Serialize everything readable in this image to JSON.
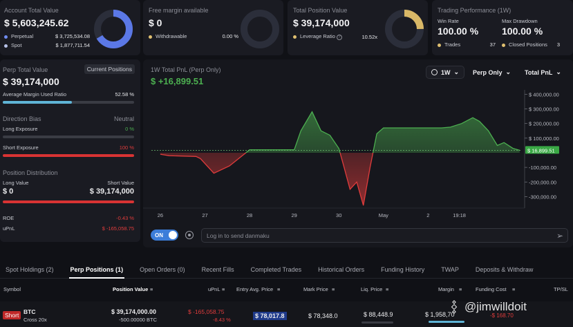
{
  "account": {
    "title": "Account Total Value",
    "value": "$ 5,603,245.62",
    "perp_label": "Perpetual",
    "perp_value": "$ 3,725,534.08",
    "spot_label": "Spot",
    "spot_value": "$ 1,877,711.54"
  },
  "margin": {
    "title": "Free margin available",
    "value": "$ 0",
    "withdrawable_label": "Withdrawable",
    "withdrawable_value": "0.00 %"
  },
  "position": {
    "title": "Total Position Value",
    "value": "$ 39,174,000",
    "leverage_label": "Leverage Ratio",
    "leverage_value": "10.52x"
  },
  "performance": {
    "title": "Trading Performance (1W)",
    "winrate_label": "Win Rate",
    "winrate_value": "100.00 %",
    "drawdown_label": "Max Drawdown",
    "drawdown_value": "100.00 %",
    "trades_label": "Trades",
    "trades_value": "37",
    "closed_label": "Closed Positions",
    "closed_value": "3"
  },
  "perp": {
    "title": "Perp Total Value",
    "button": "Current Positions",
    "value": "$ 39,174,000",
    "margin_used_label": "Average Margin Used Ratio",
    "margin_used_value": "52.58 %",
    "margin_used_fraction": 0.5258,
    "bias_label": "Direction Bias",
    "bias_value": "Neutral",
    "long_label": "Long Exposure",
    "long_value": "0 %",
    "short_label": "Short Exposure",
    "short_value": "100 %",
    "dist_label": "Position Distribution",
    "long_value_label": "Long Value",
    "short_value_label": "Short Value",
    "long_amount": "$ 0",
    "short_amount": "$ 39,174,000",
    "roe_label": "ROE",
    "roe_value": "-0.43 %",
    "upnl_label": "uPnL",
    "upnl_value": "$ -165,058.75"
  },
  "chart": {
    "title": "1W Total PnL (Perp Only)",
    "value": "$ +16,899.51",
    "period": "1W",
    "mode": "Perp Only",
    "metric": "Total PnL",
    "current_label": "$ 16,899.51"
  },
  "chart_data": {
    "type": "area",
    "title": "1W Total PnL (Perp Only)",
    "x_ticks": [
      "26",
      "27",
      "28",
      "29",
      "30",
      "May",
      "2",
      "19:18"
    ],
    "y_ticks": [
      "$ 400,000.00",
      "$ 300,000.00",
      "$ 200,000.00",
      "$ 100,000.00",
      "$ 0",
      "-100,000.00",
      "-200,000.00",
      "-300,000.00"
    ],
    "y_tick_values": [
      400000,
      300000,
      200000,
      100000,
      0,
      -100000,
      -200000,
      -300000
    ],
    "ylim": [
      -350000,
      430000
    ],
    "x": [
      0,
      0.2,
      0.8,
      0.9,
      1.2,
      1.55,
      2.0,
      2.5,
      3.0,
      3.15,
      3.4,
      3.6,
      3.8,
      4.0,
      4.1,
      4.25,
      4.4,
      4.55,
      4.7,
      4.85,
      5.0,
      5.2,
      5.45,
      5.6,
      5.7,
      5.85,
      5.95,
      6.1,
      6.3,
      6.5,
      6.75,
      7.0,
      7.15,
      7.35,
      7.55,
      7.7,
      7.9,
      8.05
    ],
    "values": [
      -10000,
      -20000,
      -25000,
      -40000,
      -140000,
      -90000,
      20000,
      20000,
      20000,
      150000,
      280000,
      150000,
      120000,
      30000,
      -80000,
      -250000,
      -200000,
      -360000,
      -100000,
      130000,
      170000,
      170000,
      170000,
      170000,
      170000,
      170000,
      170000,
      170000,
      170000,
      175000,
      200000,
      240000,
      215000,
      150000,
      50000,
      70000,
      30000,
      16899.51
    ],
    "grid": false,
    "legend": "none",
    "positive_color": "#4caf50",
    "negative_color": "#e03c3c"
  },
  "danmaku": {
    "toggle": "ON",
    "placeholder": "Log in to send danmaku"
  },
  "tabs": [
    "Spot Holdings (2)",
    "Perp Positions (1)",
    "Open Orders (0)",
    "Recent Fills",
    "Completed Trades",
    "Historical Orders",
    "Funding History",
    "TWAP",
    "Deposits & Withdraw"
  ],
  "table": {
    "headers": {
      "symbol": "Symbol",
      "position_value": "Position Value",
      "upnl": "uPnL",
      "entry": "Entry Avg. Price",
      "mark": "Mark Price",
      "liq": "Liq. Price",
      "margin": "Margin",
      "funding": "Funding Cost",
      "tpsl": "TP/SL"
    },
    "row": {
      "side": "Short",
      "symbol": "BTC",
      "mode": "Cross 20x",
      "position_value": "$ 39,174,000.00",
      "size": "-500.00000 BTC",
      "upnl": "$ -165,058.75",
      "roe": "-8.43 %",
      "entry": "$ 78,017.8",
      "mark": "$ 78,348.0",
      "liq": "$ 88,448.9",
      "margin": "$ 1,958,70",
      "funding": "-$ 168.70"
    }
  },
  "watermark": "@jimwilldoit",
  "colors": {
    "accent_blue": "#5b8def",
    "green": "#4caf50",
    "red": "#e03c3c",
    "yellow": "#e0c070"
  }
}
